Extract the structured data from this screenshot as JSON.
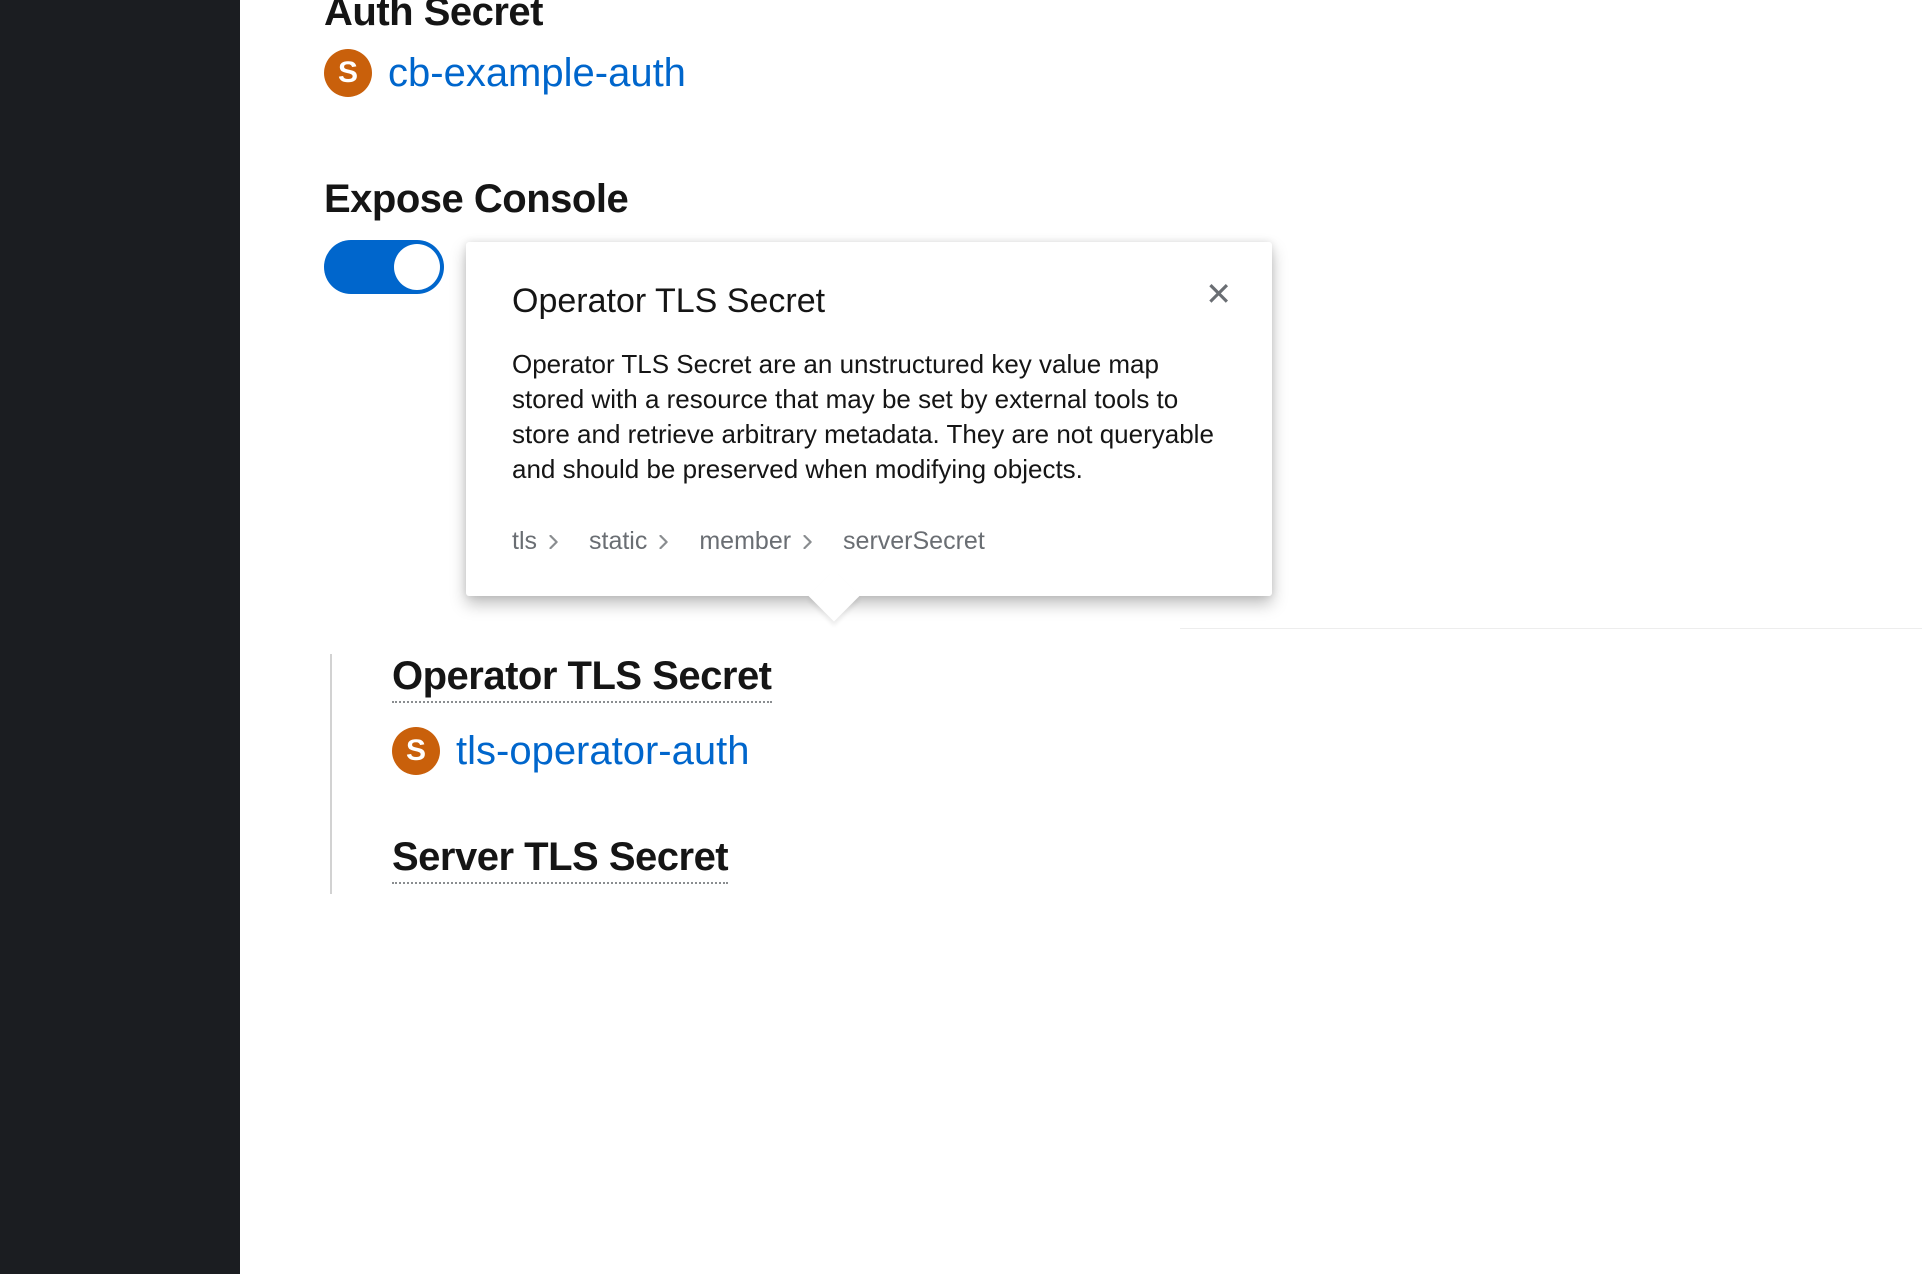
{
  "fields": {
    "auth_secret": {
      "label": "Auth Secret",
      "badge": "S",
      "link": "cb-example-auth"
    },
    "expose_console": {
      "label": "Expose Console"
    },
    "operator_tls": {
      "label": "Operator TLS Secret",
      "badge": "S",
      "link": "tls-operator-auth"
    },
    "server_tls": {
      "label": "Server TLS Secret"
    }
  },
  "popover": {
    "title": "Operator TLS Secret",
    "body": "Operator TLS Secret are an unstructured key value map stored with a resource that may be set by external tools to store and retrieve arbitrary metadata. They are not queryable and should be preserved when modifying objects.",
    "breadcrumb": [
      "tls",
      "static",
      "member",
      "serverSecret"
    ]
  }
}
